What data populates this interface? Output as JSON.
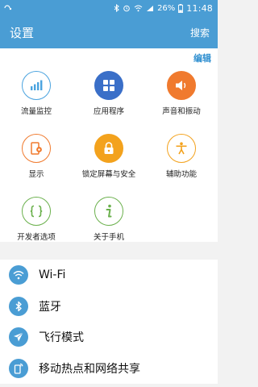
{
  "status_bar": {
    "time": "11:48",
    "battery_percent": "26%"
  },
  "app_bar": {
    "title": "设置",
    "search_label": "搜索"
  },
  "grid": {
    "edit_label": "编辑",
    "tiles": [
      {
        "label": "流量监控",
        "icon": "data-usage-icon",
        "color": "#4aa3df"
      },
      {
        "label": "应用程序",
        "icon": "applications-icon",
        "color": "#3a6fc8"
      },
      {
        "label": "声音和振动",
        "icon": "sound-icon",
        "color": "#f07a2e"
      },
      {
        "label": "显示",
        "icon": "display-icon",
        "color": "#f07a2e"
      },
      {
        "label": "锁定屏幕与安全",
        "icon": "lock-icon",
        "color": "#f3a21d"
      },
      {
        "label": "辅助功能",
        "icon": "accessibility-icon",
        "color": "#f3a21d"
      },
      {
        "label": "开发者选项",
        "icon": "developer-options-icon",
        "color": "#6ab04c"
      },
      {
        "label": "关于手机",
        "icon": "about-phone-icon",
        "color": "#6ab04c"
      }
    ]
  },
  "list": {
    "items": [
      {
        "label": "Wi-Fi",
        "icon": "wifi-icon"
      },
      {
        "label": "蓝牙",
        "icon": "bluetooth-icon"
      },
      {
        "label": "飞行模式",
        "icon": "airplane-icon"
      },
      {
        "label": "移动热点和网络共享",
        "icon": "hotspot-icon"
      }
    ]
  }
}
